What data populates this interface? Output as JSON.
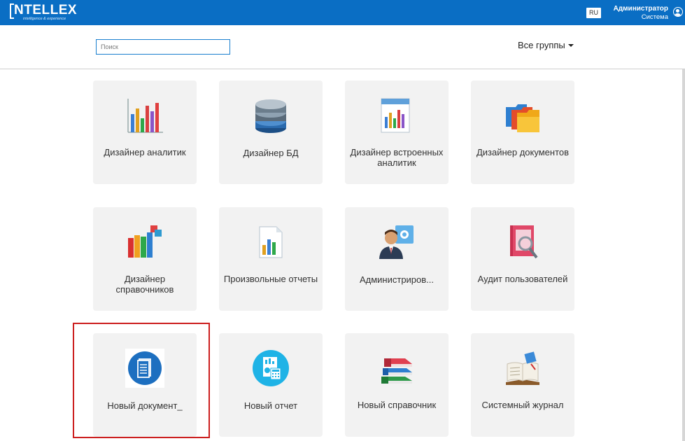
{
  "header": {
    "logo_text": "NTELLEX",
    "logo_tagline": "intelligence & experience",
    "language": "RU",
    "user_name": "Администратор",
    "user_role": "Система"
  },
  "search": {
    "placeholder": "Поиск"
  },
  "groups_dropdown": {
    "label": "Все группы"
  },
  "tiles": [
    {
      "label": "Дизайнер аналитик",
      "icon": "bar-chart-icon"
    },
    {
      "label": "Дизайнер БД",
      "icon": "database-icon"
    },
    {
      "label": "Дизайнер встроенных аналитик",
      "icon": "report-chart-icon"
    },
    {
      "label": "Дизайнер документов",
      "icon": "folders-icon"
    },
    {
      "label": "Дизайнер справочников",
      "icon": "books-icon"
    },
    {
      "label": "Произвольные отчеты",
      "icon": "document-chart-icon"
    },
    {
      "label": "Администриров...",
      "icon": "admin-user-icon"
    },
    {
      "label": "Аудит пользователей",
      "icon": "audit-icon"
    },
    {
      "label": "Новый документ_",
      "icon": "new-document-icon"
    },
    {
      "label": "Новый отчет",
      "icon": "new-report-icon"
    },
    {
      "label": "Новый справочник",
      "icon": "stacked-books-icon"
    },
    {
      "label": "Системный журнал",
      "icon": "journal-icon"
    }
  ],
  "colors": {
    "topbar": "#0a6ec4",
    "tile_bg": "#f2f2f2",
    "highlight": "#cc1f1f"
  }
}
